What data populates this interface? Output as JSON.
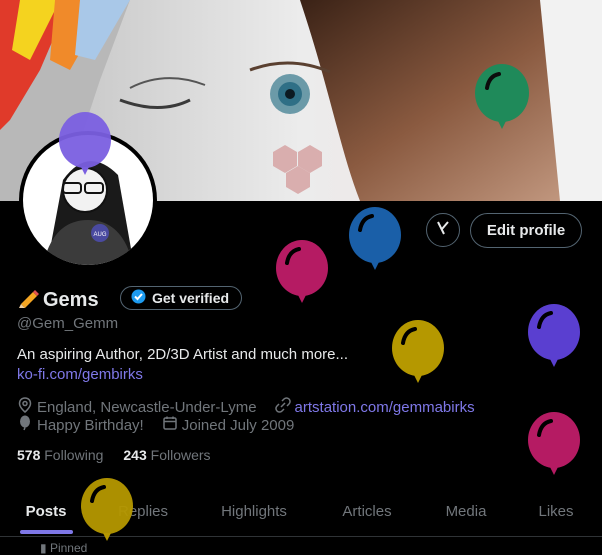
{
  "profile": {
    "name": "Gems",
    "handle": "@Gem_Gemm",
    "verify_label": "Get verified",
    "edit_label": "Edit profile",
    "bio": "An aspiring Author, 2D/3D Artist and much more...",
    "bio_link": "ko-fi.com/gembirks",
    "location": "England, Newcastle-Under-Lyme",
    "website": "artstation.com/gemmabirks",
    "birthday": "Happy Birthday!",
    "joined": "Joined July 2009",
    "following_count": "578",
    "following_label": "Following",
    "followers_count": "243",
    "followers_label": "Followers",
    "avatar_badge": "AUG"
  },
  "tabs": [
    "Posts",
    "Replies",
    "Highlights",
    "Articles",
    "Media",
    "Likes"
  ],
  "pinned_label": "Pinned",
  "colors": {
    "accent": "#7f78e8",
    "verified": "#1d9bf0",
    "background": "#000000"
  },
  "icons": [
    "pencil-icon",
    "verified-check-icon",
    "grok-icon",
    "location-icon",
    "link-icon",
    "balloon-icon",
    "calendar-icon",
    "pin-icon"
  ]
}
